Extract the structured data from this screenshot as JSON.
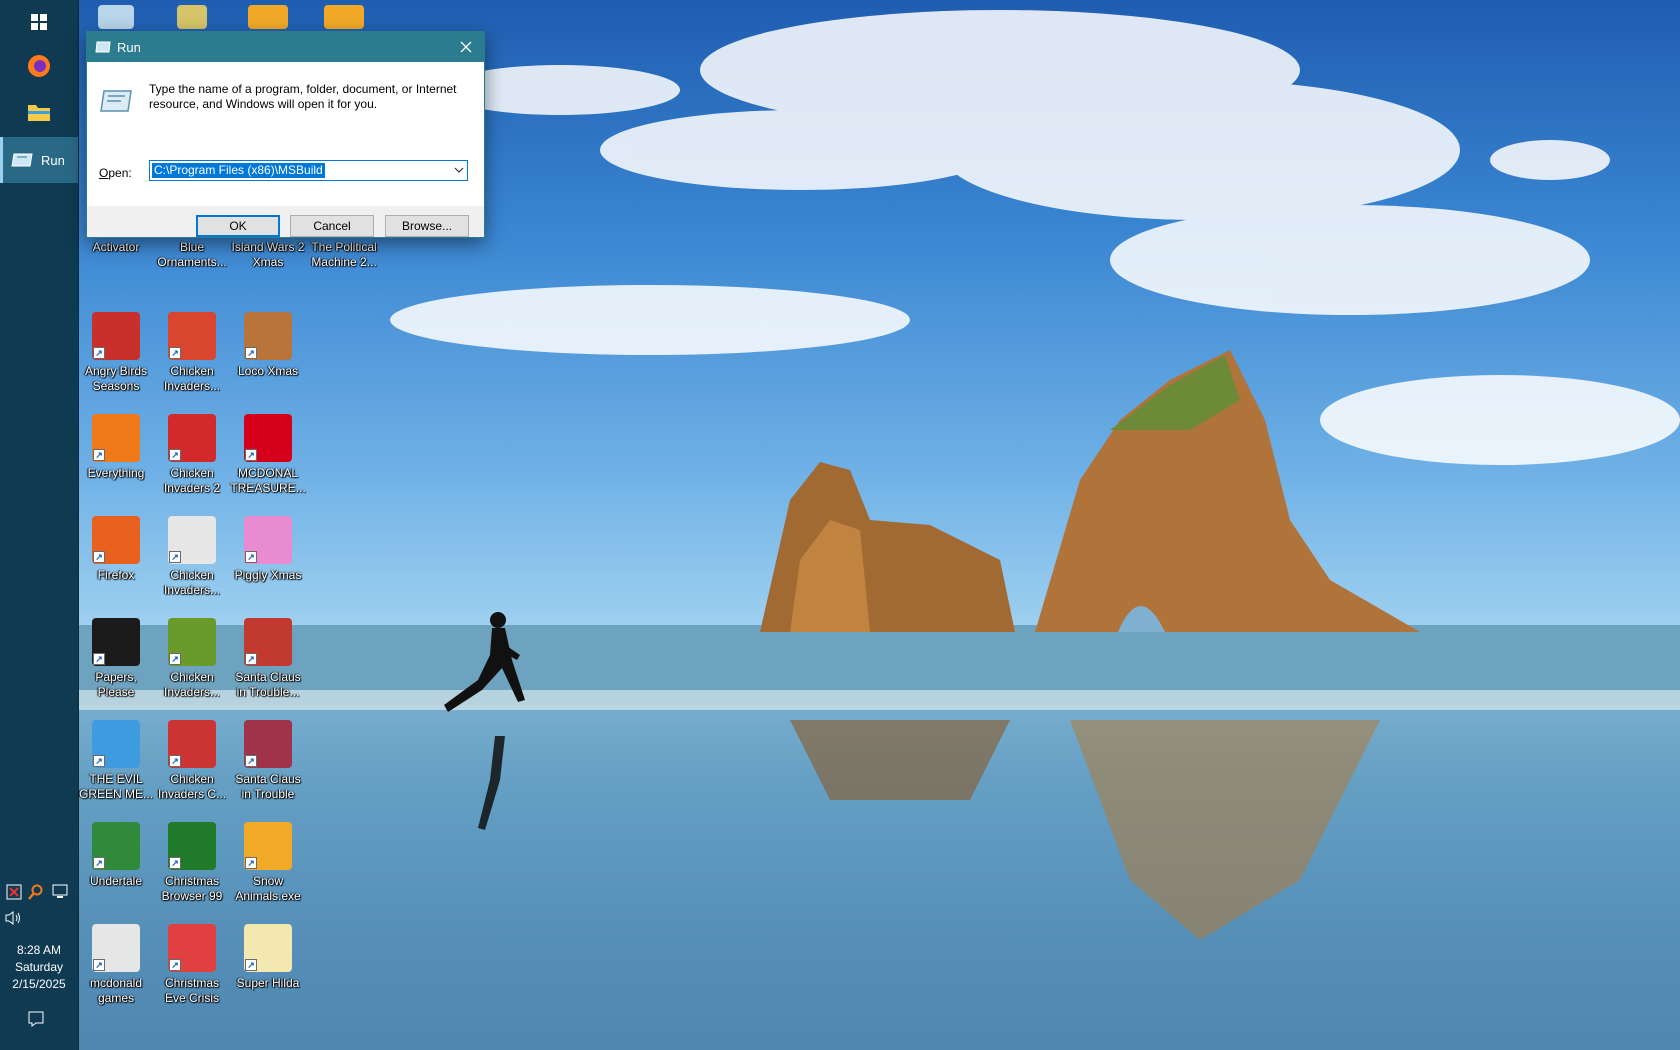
{
  "taskbar": {
    "running_item_label": "Run",
    "clock": {
      "time": "8:28 AM",
      "day": "Saturday",
      "date": "2/15/2025"
    }
  },
  "desktop": {
    "top_row_labels": [
      "Activator",
      "Blue Ornaments...",
      "Island Wars 2 Xmas",
      "The Political Machine 2..."
    ],
    "icons": [
      {
        "label": "Angry Birds Seasons",
        "icon": "angry-birds-icon",
        "color": "#c9302c"
      },
      {
        "label": "Chicken Invaders...",
        "icon": "chicken-invaders-icon",
        "color": "#d8462f"
      },
      {
        "label": "Loco Xmas",
        "icon": "teddy-bear-icon",
        "color": "#b8743a"
      },
      {
        "label": "Everything",
        "icon": "magnifier-icon",
        "color": "#f07a1a"
      },
      {
        "label": "Chicken Invaders 2",
        "icon": "chicken-invaders-2-icon",
        "color": "#d22a2a"
      },
      {
        "label": "MCDONAL TREASURE...",
        "icon": "mcdonalds-icon",
        "color": "#d6001c"
      },
      {
        "label": "Firefox",
        "icon": "firefox-icon",
        "color": "#e8611f"
      },
      {
        "label": "Chicken Invaders...",
        "icon": "chicken-invaders-icon",
        "color": "#e6e6e6"
      },
      {
        "label": "Piggly Xmas",
        "icon": "pig-icon",
        "color": "#e88bd0"
      },
      {
        "label": "Papers, Please",
        "icon": "papers-please-icon",
        "color": "#1b1b1b"
      },
      {
        "label": "Chicken Invaders...",
        "icon": "chicken-invaders-icon",
        "color": "#6a9a2a"
      },
      {
        "label": "Santa Claus in Trouble...",
        "icon": "santa-icon",
        "color": "#c23a2f"
      },
      {
        "label": "THE EVIL GREEN ME...",
        "icon": "msn-people-icon",
        "color": "#3f9be0"
      },
      {
        "label": "Chicken Invaders C...",
        "icon": "chicken-invaders-icon",
        "color": "#c33"
      },
      {
        "label": "Santa Claus in Trouble",
        "icon": "santa-icon",
        "color": "#a0324a"
      },
      {
        "label": "Undertale",
        "icon": "undertale-icon",
        "color": "#2f8a3a"
      },
      {
        "label": "Christmas Browser 99",
        "icon": "christmas-tree-icon",
        "color": "#1f7a2a"
      },
      {
        "label": "Snow Animals.exe",
        "icon": "snow-animals-icon",
        "color": "#f2a928"
      },
      {
        "label": "mcdonald games",
        "icon": "folder-icon",
        "color": "#e6e6e6"
      },
      {
        "label": "Christmas Eve Crisis",
        "icon": "santa-face-icon",
        "color": "#e04040"
      },
      {
        "label": "Super Hilda",
        "icon": "pixel-cat-icon",
        "color": "#f3e8b0"
      }
    ]
  },
  "run_dialog": {
    "title": "Run",
    "description": "Type the name of a program, folder, document, or Internet resource, and Windows will open it for you.",
    "open_label": "Open:",
    "input_value": "C:\\Program Files (x86)\\MSBuild",
    "ok_label": "OK",
    "cancel_label": "Cancel",
    "browse_label": "Browse..."
  },
  "colors": {
    "taskbar_bg": "#0f3a52",
    "titlebar_bg": "#2b7c8f",
    "accent": "#0078d7"
  }
}
